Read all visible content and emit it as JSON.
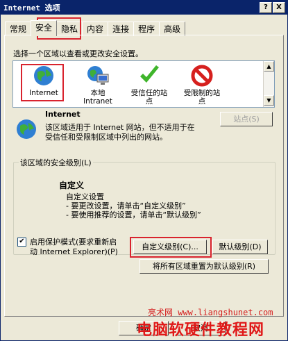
{
  "window": {
    "title": "Internet 选项",
    "help_btn": "?",
    "close_btn": "X"
  },
  "tabs": [
    "常规",
    "安全",
    "隐私",
    "内容",
    "连接",
    "程序",
    "高级"
  ],
  "security": {
    "instruction": "选择一个区域以查看或更改安全设置。",
    "zones": [
      {
        "label": "Internet",
        "icon": "globe-icon"
      },
      {
        "label": "本地\nIntranet",
        "icon": "intranet-icon"
      },
      {
        "label": "受信任的站\n点",
        "icon": "check-icon"
      },
      {
        "label": "受限制的站\n点",
        "icon": "blocked-icon"
      }
    ],
    "zone_name": "Internet",
    "sites_button": "站点(S)",
    "zone_desc": "该区域适用于 Internet 网站，但不适用于在\n受信任和受限制区域中列出的网站。",
    "level_group_label": "该区域的安全级别(L)",
    "level_title": "自定义",
    "level_lines": [
      "自定义设置",
      "- 要更改设置，请单击“自定义级别”",
      "- 要使用推荐的设置，请单击“默认级别”"
    ],
    "protected_mode": "启用保护模式(要求重新启\n动 Internet Explorer)(P)",
    "protected_checked": "✔",
    "custom_level_button": "自定义级别(C)...",
    "default_level_button": "默认级别(D)",
    "reset_all_button": "将所有区域重置为默认级别(R)"
  },
  "footer": {
    "ok": "确定",
    "cancel": "取消"
  },
  "watermark": {
    "site": "亮术网 www.liangshunet.com",
    "text": "电脑软硬件教程网"
  },
  "colors": {
    "highlight_box": "#d9232e",
    "titlebar": "#0a246a"
  }
}
